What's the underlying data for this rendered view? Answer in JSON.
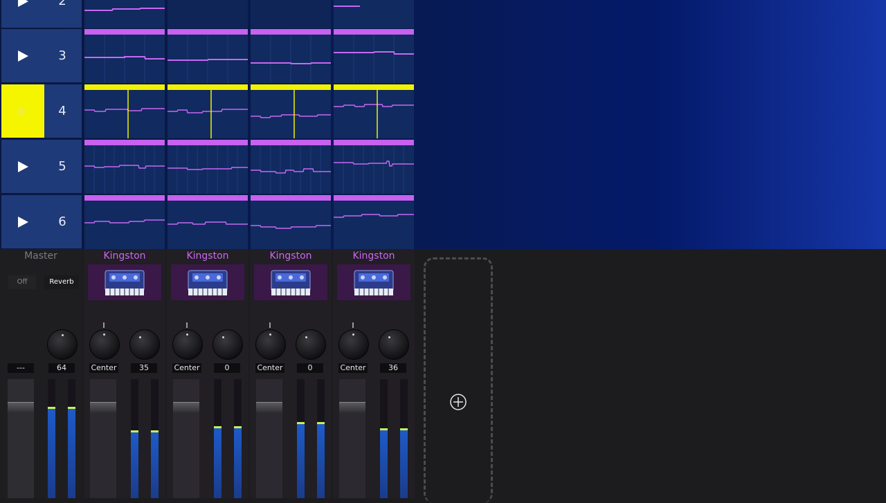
{
  "session": {
    "scenes": [
      {
        "number": "2",
        "active": false
      },
      {
        "number": "3",
        "active": false
      },
      {
        "number": "4",
        "active": true
      },
      {
        "number": "5",
        "active": false
      },
      {
        "number": "6",
        "active": false
      }
    ],
    "colors": {
      "clip_header": "#c860f0",
      "active_clip_header": "#f2f200",
      "active_launch": "#f5f500",
      "clip_body": "#112a60",
      "note_line": "#c868f2"
    }
  },
  "mixer": {
    "master": {
      "label": "Master",
      "off_label": "Off",
      "reverb_label": "Reverb",
      "pan_value": "---",
      "send_value": "64"
    },
    "channels": [
      {
        "name": "Kingston",
        "pan_value": "Center",
        "send_value": "35",
        "meter_level": 0.55
      },
      {
        "name": "Kingston",
        "pan_value": "Center",
        "send_value": "0",
        "meter_level": 0.59
      },
      {
        "name": "Kingston",
        "pan_value": "Center",
        "send_value": "0",
        "meter_level": 0.62
      },
      {
        "name": "Kingston",
        "pan_value": "Center",
        "send_value": "36",
        "meter_level": 0.57
      }
    ],
    "master_meter_level": 0.75,
    "add_track_icon": "plus-circle-icon"
  }
}
